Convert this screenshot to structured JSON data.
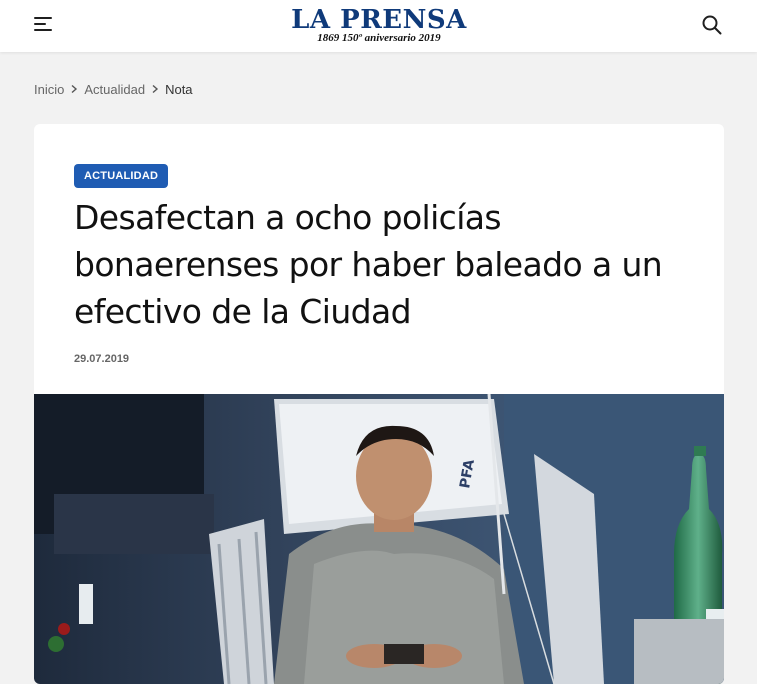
{
  "header": {
    "logo_title": "LA PRENSA",
    "logo_subtitle": "1869  150º aniversario  2019",
    "menu_icon": "hamburger-menu-icon",
    "search_icon": "search-icon"
  },
  "breadcrumb": {
    "items": [
      "Inicio",
      "Actualidad"
    ],
    "current": "Nota",
    "separator_icon": "chevron-right-icon"
  },
  "article": {
    "category": "ACTUALIDAD",
    "title": "Desafectan a ocho policías bonaerenses por haber baleado a un efectivo de la Ciudad",
    "date": "29.07.2019",
    "image_text": "PFA"
  },
  "colors": {
    "brand": "#0f3a7a",
    "badge": "#1f5cb3",
    "background": "#f2f2f2"
  }
}
